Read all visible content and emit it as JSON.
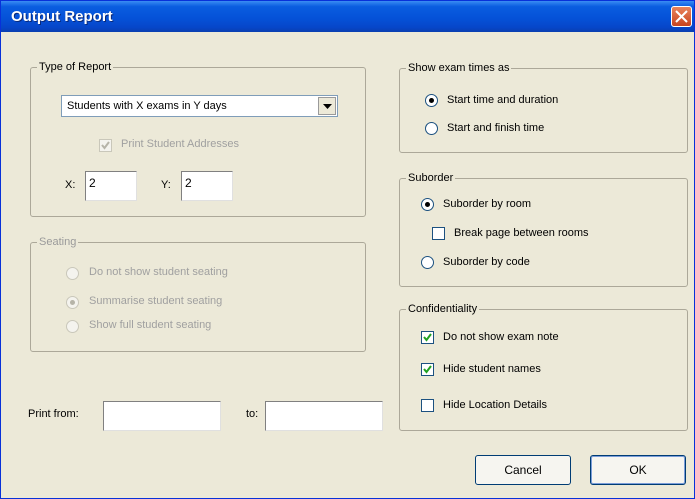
{
  "window": {
    "title": "Output Report"
  },
  "type_of_report": {
    "legend": "Type of Report",
    "report_type": "Students with X exams in Y days",
    "print_addresses_label": "Print Student Addresses",
    "print_addresses_checked": true,
    "print_addresses_enabled": false,
    "x_label": "X:",
    "x_value": "2",
    "y_label": "Y:",
    "y_value": "2"
  },
  "seating": {
    "legend": "Seating",
    "enabled": false,
    "options": [
      {
        "label": "Do not show student seating",
        "selected": false
      },
      {
        "label": "Summarise student seating",
        "selected": true
      },
      {
        "label": "Show full student seating",
        "selected": false
      }
    ]
  },
  "print_range": {
    "from_label": "Print from:",
    "from_value": "",
    "to_label": "to:",
    "to_value": ""
  },
  "show_exam_times": {
    "legend": "Show exam times as",
    "options": [
      {
        "label": "Start time and duration",
        "selected": true
      },
      {
        "label": "Start and finish time",
        "selected": false
      }
    ]
  },
  "suborder": {
    "legend": "Suborder",
    "by_room_label": "Suborder by room",
    "by_room_selected": true,
    "break_page_label": "Break page between rooms",
    "break_page_checked": false,
    "by_code_label": "Suborder by code",
    "by_code_selected": false
  },
  "confidentiality": {
    "legend": "Confidentiality",
    "options": [
      {
        "label": "Do not show exam note",
        "checked": true
      },
      {
        "label": "Hide student names",
        "checked": true
      },
      {
        "label": "Hide Location Details",
        "checked": false
      }
    ]
  },
  "buttons": {
    "cancel": "Cancel",
    "ok": "OK"
  }
}
